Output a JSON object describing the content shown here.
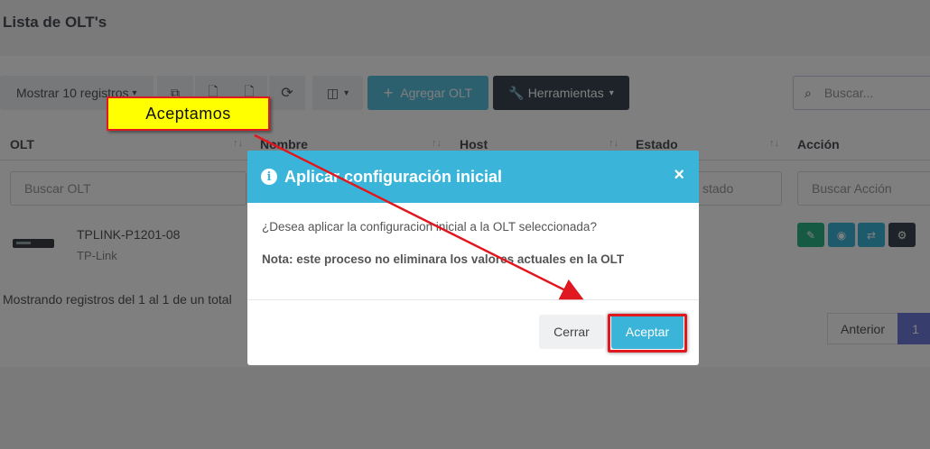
{
  "page": {
    "title": "Lista de OLT's"
  },
  "toolbar": {
    "show_label": "Mostrar 10 registros",
    "add_label": "Agregar OLT",
    "tools_label": "Herramientas",
    "search_placeholder": "Buscar..."
  },
  "table": {
    "headers": [
      "OLT",
      "Nombre",
      "Host",
      "Estado",
      "Acción"
    ],
    "filter_placeholders": {
      "olt": "Buscar OLT",
      "estado": "stado",
      "accion": "Buscar Acción"
    },
    "rows": [
      {
        "name": "TPLINK-P1201-08",
        "brand": "TP-Link"
      }
    ],
    "footer": "Mostrando registros del 1 al 1 de un total",
    "pagination": {
      "prev": "Anterior",
      "current": "1"
    }
  },
  "modal": {
    "title": "Aplicar configuración inicial",
    "question": "¿Desea aplicar la configuracion inicial a la OLT seleccionada?",
    "note": "Nota: este proceso no eliminara los valores actuales en la OLT",
    "close_label": "Cerrar",
    "accept_label": "Aceptar",
    "close_symbol": "×"
  },
  "annotation": {
    "callout": "Aceptamos"
  },
  "colors": {
    "accent": "#3ab4d8",
    "dark_button": "#3a4651",
    "highlight": "#e0181f",
    "callout_bg": "#ffff00"
  }
}
